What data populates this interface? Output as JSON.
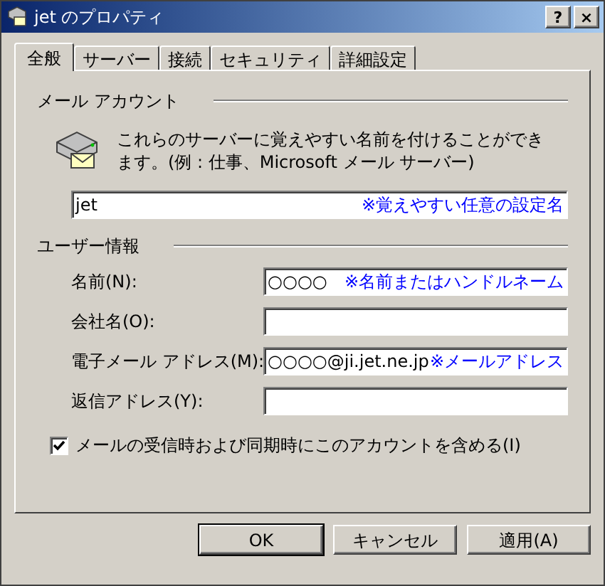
{
  "window": {
    "title": "jet のプロパティ",
    "buttons": [
      "?",
      "×"
    ]
  },
  "tabs": [
    {
      "label": "全般",
      "selected": true
    },
    {
      "label": "サーバー",
      "selected": false
    },
    {
      "label": "接続",
      "selected": false
    },
    {
      "label": "セキュリティ",
      "selected": false
    },
    {
      "label": "詳細設定",
      "selected": false
    }
  ],
  "mail_account": {
    "heading": "メール アカウント",
    "description": "これらのサーバーに覚えやすい名前を付けることができます。(例 : 仕事、Microsoft メール サーバー)",
    "value": "jet",
    "note": "※覚えやすい任意の設定名"
  },
  "user_info": {
    "heading": "ユーザー情報",
    "fields": [
      {
        "label": "名前(N):",
        "value": "○○○○",
        "note": "※名前またはハンドルネーム"
      },
      {
        "label": "会社名(O):"
      },
      {
        "label": "電子メール アドレス(M):",
        "value": "○○○○@ji.jet.ne.jp",
        "note": "※メールアドレス"
      },
      {
        "label": "返信アドレス(Y):"
      }
    ]
  },
  "include_checkbox": {
    "label": "メールの受信時および同期時にこのアカウントを含める(I)",
    "checked": true
  },
  "buttons": [
    {
      "label": "OK",
      "default": true
    },
    {
      "label": "キャンセル",
      "default": false
    },
    {
      "label": "適用(A)",
      "default": false
    }
  ]
}
